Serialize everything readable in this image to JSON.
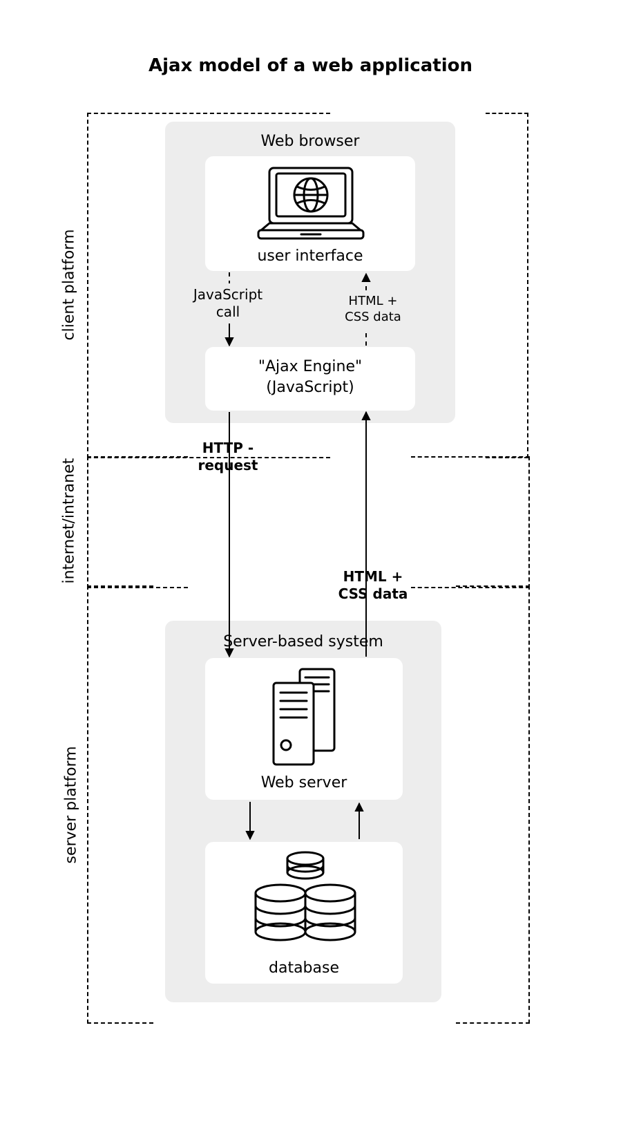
{
  "title": "Ajax model of a web application",
  "sections": {
    "client": "client platform",
    "internet": "internet/intranet",
    "server": "server platform"
  },
  "groups": {
    "browser": "Web browser",
    "server_system": "Server-based system"
  },
  "nodes": {
    "ui": "user interface",
    "ajax_engine_l1": "\"Ajax Engine\"",
    "ajax_engine_l2": "(JavaScript)",
    "web_server": "Web server",
    "database": "database"
  },
  "edges": {
    "js_call_l1": "JavaScript",
    "js_call_l2": "call",
    "html_css_up_l1": "HTML +",
    "html_css_up_l2": "CSS data",
    "http_req_l1": "HTTP -",
    "http_req_l2": "request",
    "html_css_net_l1": "HTML +",
    "html_css_net_l2": "CSS data"
  }
}
